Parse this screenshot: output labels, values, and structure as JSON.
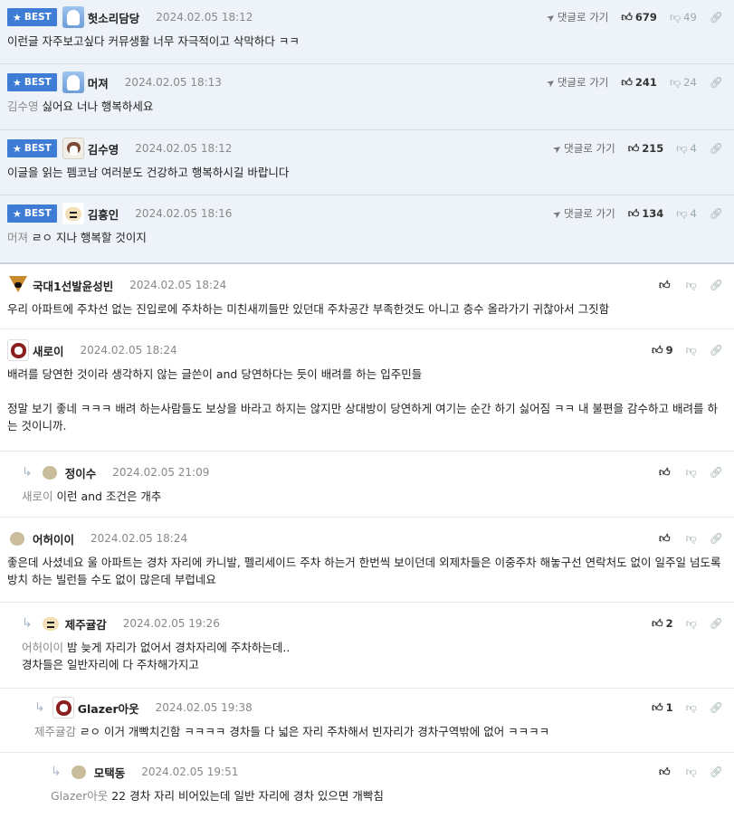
{
  "best_label": "BEST",
  "goto_label": "댓글로 가기",
  "comments": [
    {
      "nick": "헛소리담당",
      "date": "2024.02.05 18:12",
      "likes": "679",
      "dislikes": "49",
      "text": "이런글 자주보고싶다 커뮤생활 너무 자극적이고 삭막하다 ㅋㅋ",
      "avatar": "blue-bird"
    },
    {
      "nick": "머져",
      "date": "2024.02.05 18:13",
      "likes": "241",
      "dislikes": "24",
      "mention": "김수영",
      "text": " 싫어요 너나 행복하세요",
      "avatar": "blue-bird"
    },
    {
      "nick": "김수영",
      "date": "2024.02.05 18:12",
      "likes": "215",
      "dislikes": "4",
      "text": "이글을 읽는 펨코남 여러분도 건강하고 행복하시길 바랍니다",
      "avatar": "dog"
    },
    {
      "nick": "김흥인",
      "date": "2024.02.05 18:16",
      "likes": "134",
      "dislikes": "4",
      "mention": "머져",
      "text": " ㄹㅇ 지나 행복할 것이지",
      "avatar": "puppy"
    },
    {
      "nick": "국대1선발윤성빈",
      "date": "2024.02.05 18:24",
      "likes": "",
      "text": "우리 아파트에 주차선 없는 진입로에 주차하는 미친새끼들만 있던대 주차공간 부족한것도 아니고 층수 올라가기 귀찮아서 그짓함",
      "avatar": "fox"
    },
    {
      "nick": "새로이",
      "date": "2024.02.05 18:24",
      "likes": "9",
      "text": "배려를 당연한 것이라 생각하지 않는 글쓴이 and 당연하다는 듯이 배려를 하는 입주민들\n\n정말 보기 좋네 ㅋㅋㅋ 배려 하는사람들도 보상을 바라고 하지는 않지만 상대방이 당연하게 여기는 순간 하기 싫어짐 ㅋㅋ 내 불편을 감수하고 배려를 하는 것이니까.",
      "avatar": "mpu"
    },
    {
      "nick": "정이수",
      "date": "2024.02.05 21:09",
      "likes": "",
      "mention": "새로이",
      "text": " 이런 and 조건은 개추",
      "avatar": "dot"
    },
    {
      "nick": "어허이이",
      "date": "2024.02.05 18:24",
      "likes": "",
      "text": "좋은데 사셨네요 울 아파트는 경차 자리에 카니발, 펠리세이드 주차 하는거 한번씩 보이던데 외제차들은 이중주차 해놓구선 연락처도 없이 일주일 넘도록 방치 하는 빌런들 수도 없이 많은데 부럽네요",
      "avatar": "dot"
    },
    {
      "nick": "제주귤감",
      "date": "2024.02.05 19:26",
      "likes": "2",
      "mention": "어허이이",
      "text": " 밤 늦게 자리가 없어서 경차자리에 주차하는데..\n경차들은 일반자리에 다 주차해가지고",
      "avatar": "puppy"
    },
    {
      "nick": "Glazer아웃",
      "date": "2024.02.05 19:38",
      "likes": "1",
      "mention": "제주귤감",
      "text": " ㄹㅇ 이거 개빡치긴함 ㅋㅋㅋㅋ 경차들 다 넓은 자리 주차해서 빈자리가 경차구역밖에 없어 ㅋㅋㅋㅋ",
      "avatar": "mpu"
    },
    {
      "nick": "모택동",
      "date": "2024.02.05 19:51",
      "likes": "",
      "mention": "Glazer아웃",
      "text": " 22 경차 자리 비어있는데 일반 자리에 경차 있으면 개빡침",
      "avatar": "dot"
    }
  ]
}
